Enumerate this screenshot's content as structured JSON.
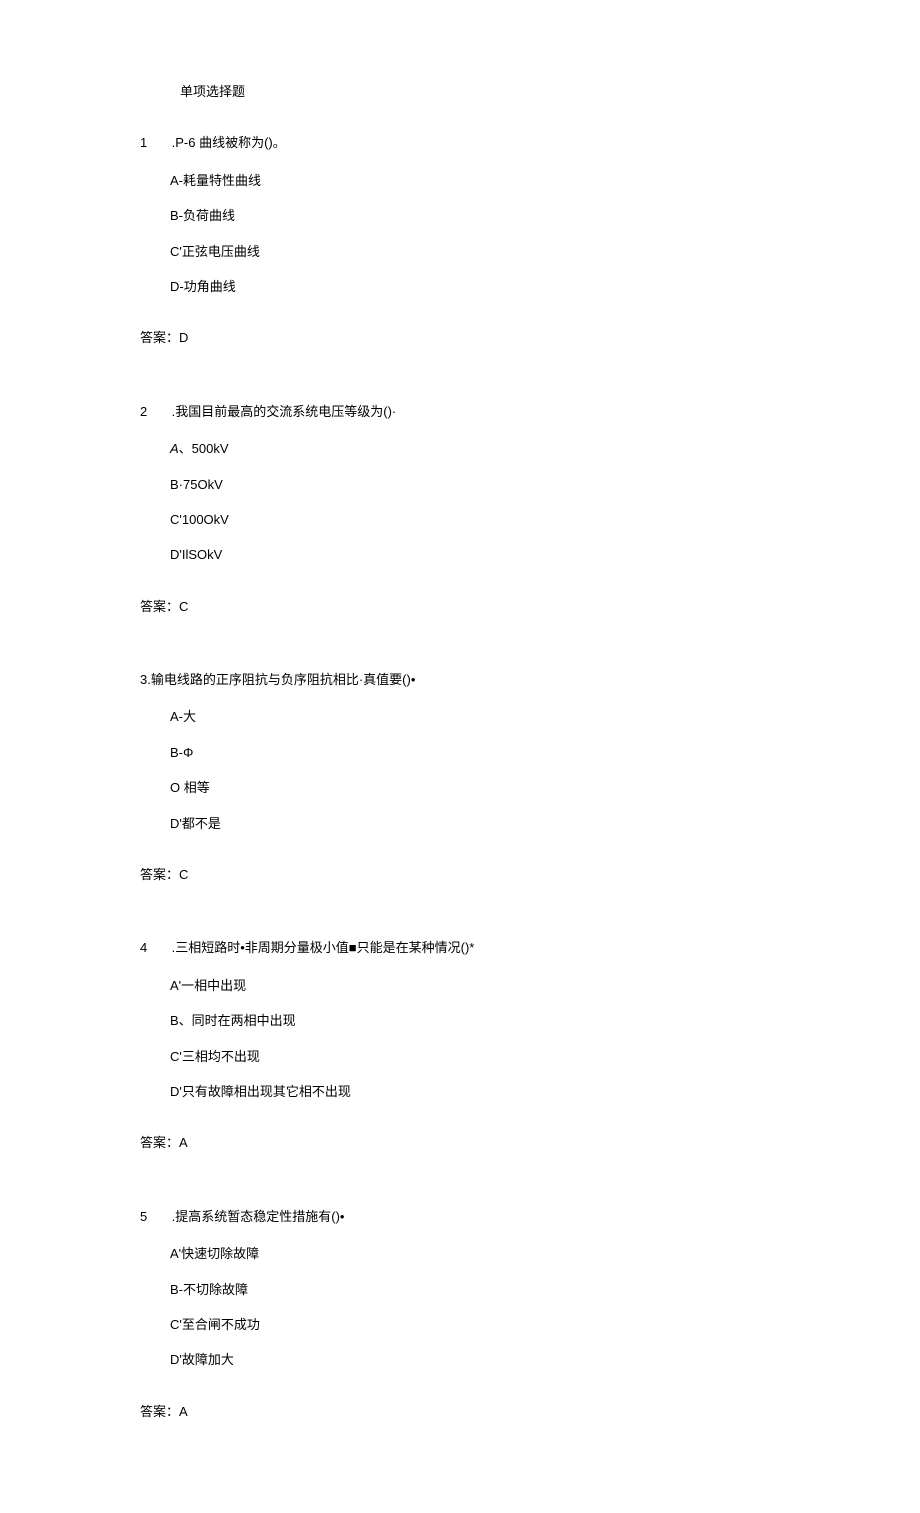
{
  "sectionTitle": "单项选择题",
  "questions": [
    {
      "number": "1",
      "stem": ".P-6 曲线被称为()。",
      "options": [
        "A-耗量特性曲线",
        "B-负荷曲线",
        "C'正弦电压曲线",
        "D-功角曲线"
      ],
      "answer": "答案：D"
    },
    {
      "number": "2",
      "stem": ".我国目前最高的交流系统电压等级为()·",
      "options": [
        "A、500kV",
        "B·75OkV",
        "C'100OkV",
        "D'IlSOkV"
      ],
      "answer": "答案：C",
      "firstOptionItalicPrefix": "A"
    },
    {
      "number": "",
      "stem": "3.输电线路的正序阻抗与负序阻抗相比·真值要()•",
      "options": [
        "A-大",
        "B-Φ",
        "O 相等",
        "D'都不是"
      ],
      "answer": "答案：C"
    },
    {
      "number": "4",
      "stem": ".三相短路时•非周期分量极小值■只能是在某种情况()*",
      "options": [
        "A'一相中出现",
        "B、同时在两相中出现",
        "C'三相均不出现",
        "D'只有故障相出现其它相不出现"
      ],
      "answer": "答案：A"
    },
    {
      "number": "5",
      "stem": ".提高系统暂态稳定性措施有()•",
      "options": [
        "A'快速切除故障",
        "B-不切除故障",
        "C'至合闸不成功",
        "D'故障加大"
      ],
      "answer": "答案：A"
    }
  ]
}
